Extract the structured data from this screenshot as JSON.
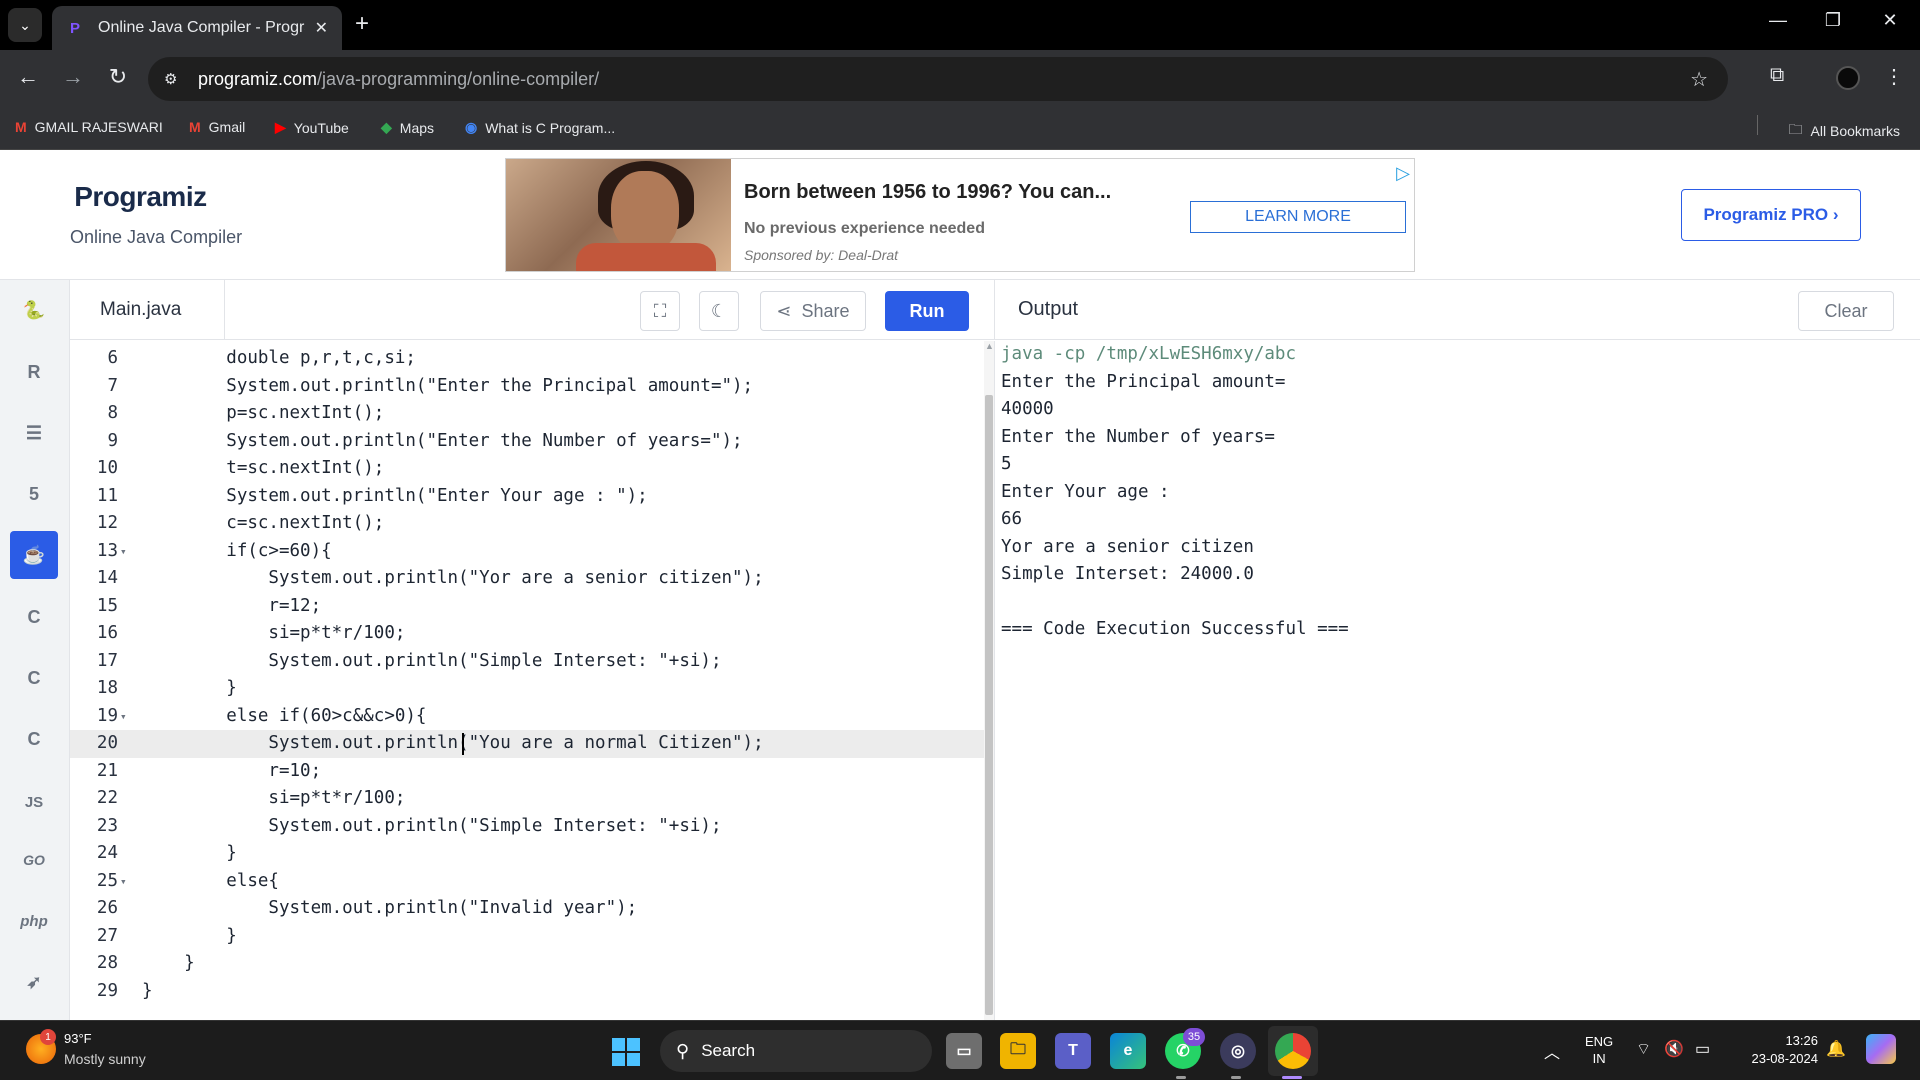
{
  "browser": {
    "tab_title": "Online Java Compiler - Program",
    "tab_close": "✕",
    "new_tab": "+",
    "url_host": "programiz.com",
    "url_path": "/java-programming/online-compiler/",
    "bookmarks": [
      {
        "label": "GMAIL RAJESWARI",
        "icon": "gmail-icon",
        "color": "#ea4335"
      },
      {
        "label": "Gmail",
        "icon": "gmail-icon",
        "color": "#ea4335"
      },
      {
        "label": "YouTube",
        "icon": "youtube-icon",
        "color": "#ff0000"
      },
      {
        "label": "Maps",
        "icon": "maps-icon",
        "color": "#34a853"
      },
      {
        "label": "What is C Program...",
        "icon": "globe-icon",
        "color": "#4285f4"
      }
    ],
    "all_bookmarks": "All Bookmarks"
  },
  "header": {
    "logo": "Programiz",
    "subtitle": "Online Java Compiler",
    "pro_button": "Programiz PRO ›"
  },
  "ad": {
    "title": "Born between 1956 to 1996? You can...",
    "subtitle": "No previous experience needed",
    "sponsor": "Sponsored by: Deal-Drat",
    "cta": "LEARN MORE"
  },
  "sidebar": {
    "items": [
      {
        "name": "python-icon",
        "glyph": "🐍"
      },
      {
        "name": "r-icon",
        "glyph": "R"
      },
      {
        "name": "sql-icon",
        "glyph": "☰"
      },
      {
        "name": "html-icon",
        "glyph": "5"
      },
      {
        "name": "java-icon",
        "glyph": "☕",
        "active": true
      },
      {
        "name": "c-icon",
        "glyph": "C"
      },
      {
        "name": "cpp-icon",
        "glyph": "C"
      },
      {
        "name": "csharp-icon",
        "glyph": "C"
      },
      {
        "name": "js-icon",
        "glyph": "JS"
      },
      {
        "name": "go-icon",
        "glyph": "GO"
      },
      {
        "name": "php-icon",
        "glyph": "php"
      },
      {
        "name": "swift-icon",
        "glyph": "➶"
      }
    ]
  },
  "editor": {
    "file_name": "Main.java",
    "share_label": "Share",
    "run_label": "Run",
    "highlight_line": 20,
    "lines": [
      {
        "n": "6",
        "fold": false,
        "code": "        double p,r,t,c,si;"
      },
      {
        "n": "7",
        "fold": false,
        "code": "        System.out.println(\"Enter the Principal amount=\");"
      },
      {
        "n": "8",
        "fold": false,
        "code": "        p=sc.nextInt();"
      },
      {
        "n": "9",
        "fold": false,
        "code": "        System.out.println(\"Enter the Number of years=\");"
      },
      {
        "n": "10",
        "fold": false,
        "code": "        t=sc.nextInt();"
      },
      {
        "n": "11",
        "fold": false,
        "code": "        System.out.println(\"Enter Your age : \");"
      },
      {
        "n": "12",
        "fold": false,
        "code": "        c=sc.nextInt();"
      },
      {
        "n": "13",
        "fold": true,
        "code": "        if(c>=60){"
      },
      {
        "n": "14",
        "fold": false,
        "code": "            System.out.println(\"Yor are a senior citizen\");"
      },
      {
        "n": "15",
        "fold": false,
        "code": "            r=12;"
      },
      {
        "n": "16",
        "fold": false,
        "code": "            si=p*t*r/100;"
      },
      {
        "n": "17",
        "fold": false,
        "code": "            System.out.println(\"Simple Interset: \"+si);"
      },
      {
        "n": "18",
        "fold": false,
        "code": "        }"
      },
      {
        "n": "19",
        "fold": true,
        "code": "        else if(60>c&&c>0){"
      },
      {
        "n": "20",
        "fold": false,
        "code": "            System.out.println(\"You are a normal Citizen\");"
      },
      {
        "n": "21",
        "fold": false,
        "code": "            r=10;"
      },
      {
        "n": "22",
        "fold": false,
        "code": "            si=p*t*r/100;"
      },
      {
        "n": "23",
        "fold": false,
        "code": "            System.out.println(\"Simple Interset: \"+si);"
      },
      {
        "n": "24",
        "fold": false,
        "code": "        }"
      },
      {
        "n": "25",
        "fold": true,
        "code": "        else{"
      },
      {
        "n": "26",
        "fold": false,
        "code": "            System.out.println(\"Invalid year\");"
      },
      {
        "n": "27",
        "fold": false,
        "code": "        }"
      },
      {
        "n": "28",
        "fold": false,
        "code": "    }"
      },
      {
        "n": "29",
        "fold": false,
        "code": "}"
      }
    ]
  },
  "output": {
    "title": "Output",
    "clear_label": "Clear",
    "command": "java -cp /tmp/xLwESH6mxy/abc",
    "lines": [
      "Enter the Principal amount=",
      "40000",
      "Enter the Number of years=",
      "5",
      "Enter Your age :",
      "66",
      "Yor are a senior citizen",
      "Simple Interset: 24000.0",
      "",
      "=== Code Execution Successful ==="
    ]
  },
  "taskbar": {
    "weather_temp": "93°F",
    "weather_desc": "Mostly sunny",
    "weather_badge": "1",
    "search_label": "Search",
    "whatsapp_badge": "35",
    "lang_top": "ENG",
    "lang_bottom": "IN",
    "time": "13:26",
    "date": "23-08-2024"
  }
}
